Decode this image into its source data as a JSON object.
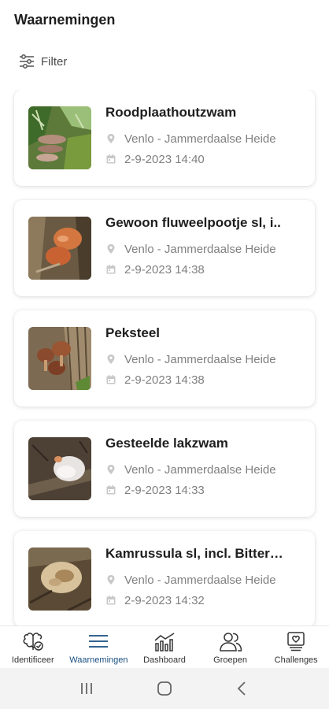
{
  "header": {
    "title": "Waarnemingen"
  },
  "filter": {
    "label": "Filter",
    "icon": "filter-sliders-icon"
  },
  "observations": [
    {
      "title": "Roodplaathoutzwam",
      "location": "Venlo - Jammerdaalse Heide",
      "datetime": "2-9-2023 14:40"
    },
    {
      "title": "Gewoon fluweelpootje sl, i..",
      "location": "Venlo - Jammerdaalse Heide",
      "datetime": "2-9-2023 14:38"
    },
    {
      "title": "Peksteel",
      "location": "Venlo - Jammerdaalse Heide",
      "datetime": "2-9-2023 14:38"
    },
    {
      "title": "Gesteelde lakzwam",
      "location": "Venlo - Jammerdaalse Heide",
      "datetime": "2-9-2023 14:33"
    },
    {
      "title": "Kamrussula sl, incl. Bitter…",
      "location": "Venlo - Jammerdaalse Heide",
      "datetime": "2-9-2023 14:32"
    }
  ],
  "nav": {
    "items": [
      {
        "label": "Identificeer",
        "icon": "identify-icon"
      },
      {
        "label": "Waarnemingen",
        "icon": "list-icon",
        "active": true
      },
      {
        "label": "Dashboard",
        "icon": "dashboard-icon"
      },
      {
        "label": "Groepen",
        "icon": "groups-icon"
      },
      {
        "label": "Challenges",
        "icon": "challenges-icon"
      }
    ]
  },
  "colors": {
    "accent": "#1a4f80",
    "meta": "#808080",
    "title": "#1e1e1e"
  }
}
